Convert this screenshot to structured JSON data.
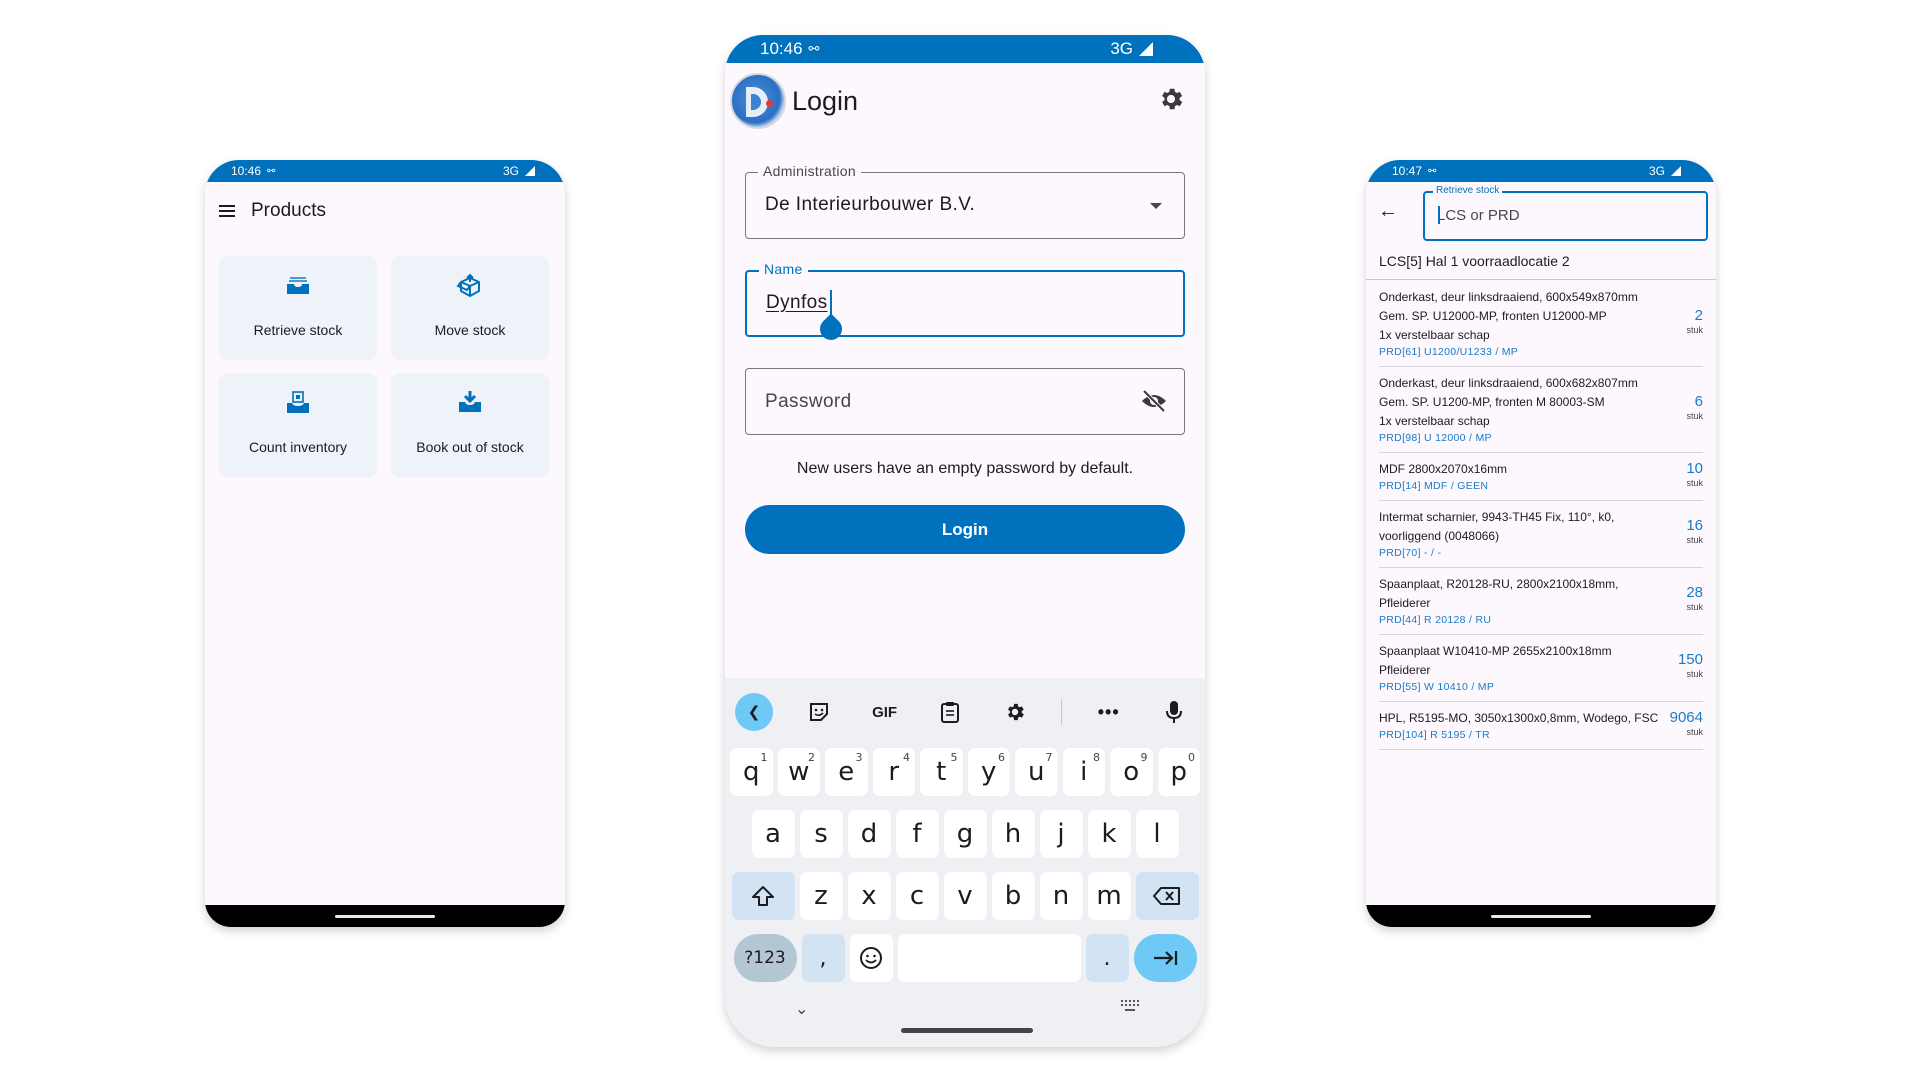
{
  "colors": {
    "accent": "#0071bc",
    "background": "#fdf8fd",
    "tile_bg": "#eef2f9",
    "keyboard_bg": "#eff0f4"
  },
  "phone_products": {
    "status": {
      "time": "10:46",
      "network": "3G"
    },
    "title": "Products",
    "tiles": [
      {
        "label": "Retrieve stock",
        "icon": "inbox-tray-icon"
      },
      {
        "label": "Move stock",
        "icon": "box-move-icon"
      },
      {
        "label": "Count inventory",
        "icon": "count-inventory-icon"
      },
      {
        "label": "Book out of stock",
        "icon": "download-tray-icon"
      }
    ]
  },
  "phone_login": {
    "status": {
      "time": "10:46",
      "network": "3G"
    },
    "title": "Login",
    "administration": {
      "label": "Administration",
      "value": "De Interieurbouwer B.V."
    },
    "name": {
      "label": "Name",
      "value": "Dynfos"
    },
    "password": {
      "placeholder": "Password"
    },
    "hint": "New users have an empty password by default.",
    "login_button": "Login",
    "keyboard": {
      "toolbar": [
        "back",
        "sticker",
        "GIF",
        "clipboard",
        "settings",
        "more",
        "microphone"
      ],
      "gif_label": "GIF",
      "row1": [
        {
          "k": "q",
          "n": "1"
        },
        {
          "k": "w",
          "n": "2"
        },
        {
          "k": "e",
          "n": "3"
        },
        {
          "k": "r",
          "n": "4"
        },
        {
          "k": "t",
          "n": "5"
        },
        {
          "k": "y",
          "n": "6"
        },
        {
          "k": "u",
          "n": "7"
        },
        {
          "k": "i",
          "n": "8"
        },
        {
          "k": "o",
          "n": "9"
        },
        {
          "k": "p",
          "n": "0"
        }
      ],
      "row2": [
        "a",
        "s",
        "d",
        "f",
        "g",
        "h",
        "j",
        "k",
        "l"
      ],
      "row3": [
        "z",
        "x",
        "c",
        "v",
        "b",
        "n",
        "m"
      ],
      "symbols_key": "?123",
      "comma_key": ",",
      "period_key": "."
    }
  },
  "phone_stock": {
    "status": {
      "time": "10:47",
      "network": "3G"
    },
    "search": {
      "label": "Retrieve stock",
      "placeholder": "LCS or PRD"
    },
    "location": "LCS[5] Hal 1 voorraadlocatie 2",
    "items": [
      {
        "lines": [
          "Onderkast, deur linksdraaiend, 600x549x870mm",
          "Gem. SP. U12000-MP, fronten U12000-MP",
          "1x verstelbaar schap"
        ],
        "code": "PRD[61] U1200/U1233 / MP",
        "qty": "2",
        "unit": "stuk"
      },
      {
        "lines": [
          "Onderkast, deur linksdraaiend, 600x682x807mm",
          "Gem. SP. U1200-MP, fronten M 80003-SM",
          "1x verstelbaar schap"
        ],
        "code": "PRD[98] U 12000 / MP",
        "qty": "6",
        "unit": "stuk"
      },
      {
        "lines": [
          "MDF 2800x2070x16mm"
        ],
        "code": "PRD[14] MDF / GEEN",
        "qty": "10",
        "unit": "stuk"
      },
      {
        "lines": [
          "Intermat scharnier, 9943-TH45 Fix, 110°, k0,",
          "voorliggend (0048066)"
        ],
        "code": "PRD[70]  -  /  -",
        "qty": "16",
        "unit": "stuk"
      },
      {
        "lines": [
          "Spaanplaat, R20128-RU, 2800x2100x18mm,",
          "Pfleiderer"
        ],
        "code": "PRD[44] R 20128 / RU",
        "qty": "28",
        "unit": "stuk"
      },
      {
        "lines": [
          "Spaanplaat W10410-MP 2655x2100x18mm",
          "Pfleiderer"
        ],
        "code": "PRD[55] W 10410 / MP",
        "qty": "150",
        "unit": "stuk"
      },
      {
        "lines": [
          "HPL, R5195-MO, 3050x1300x0,8mm, Wodego, FSC"
        ],
        "code": "PRD[104] R 5195 / TR",
        "qty": "9064",
        "unit": "stuk"
      }
    ]
  }
}
